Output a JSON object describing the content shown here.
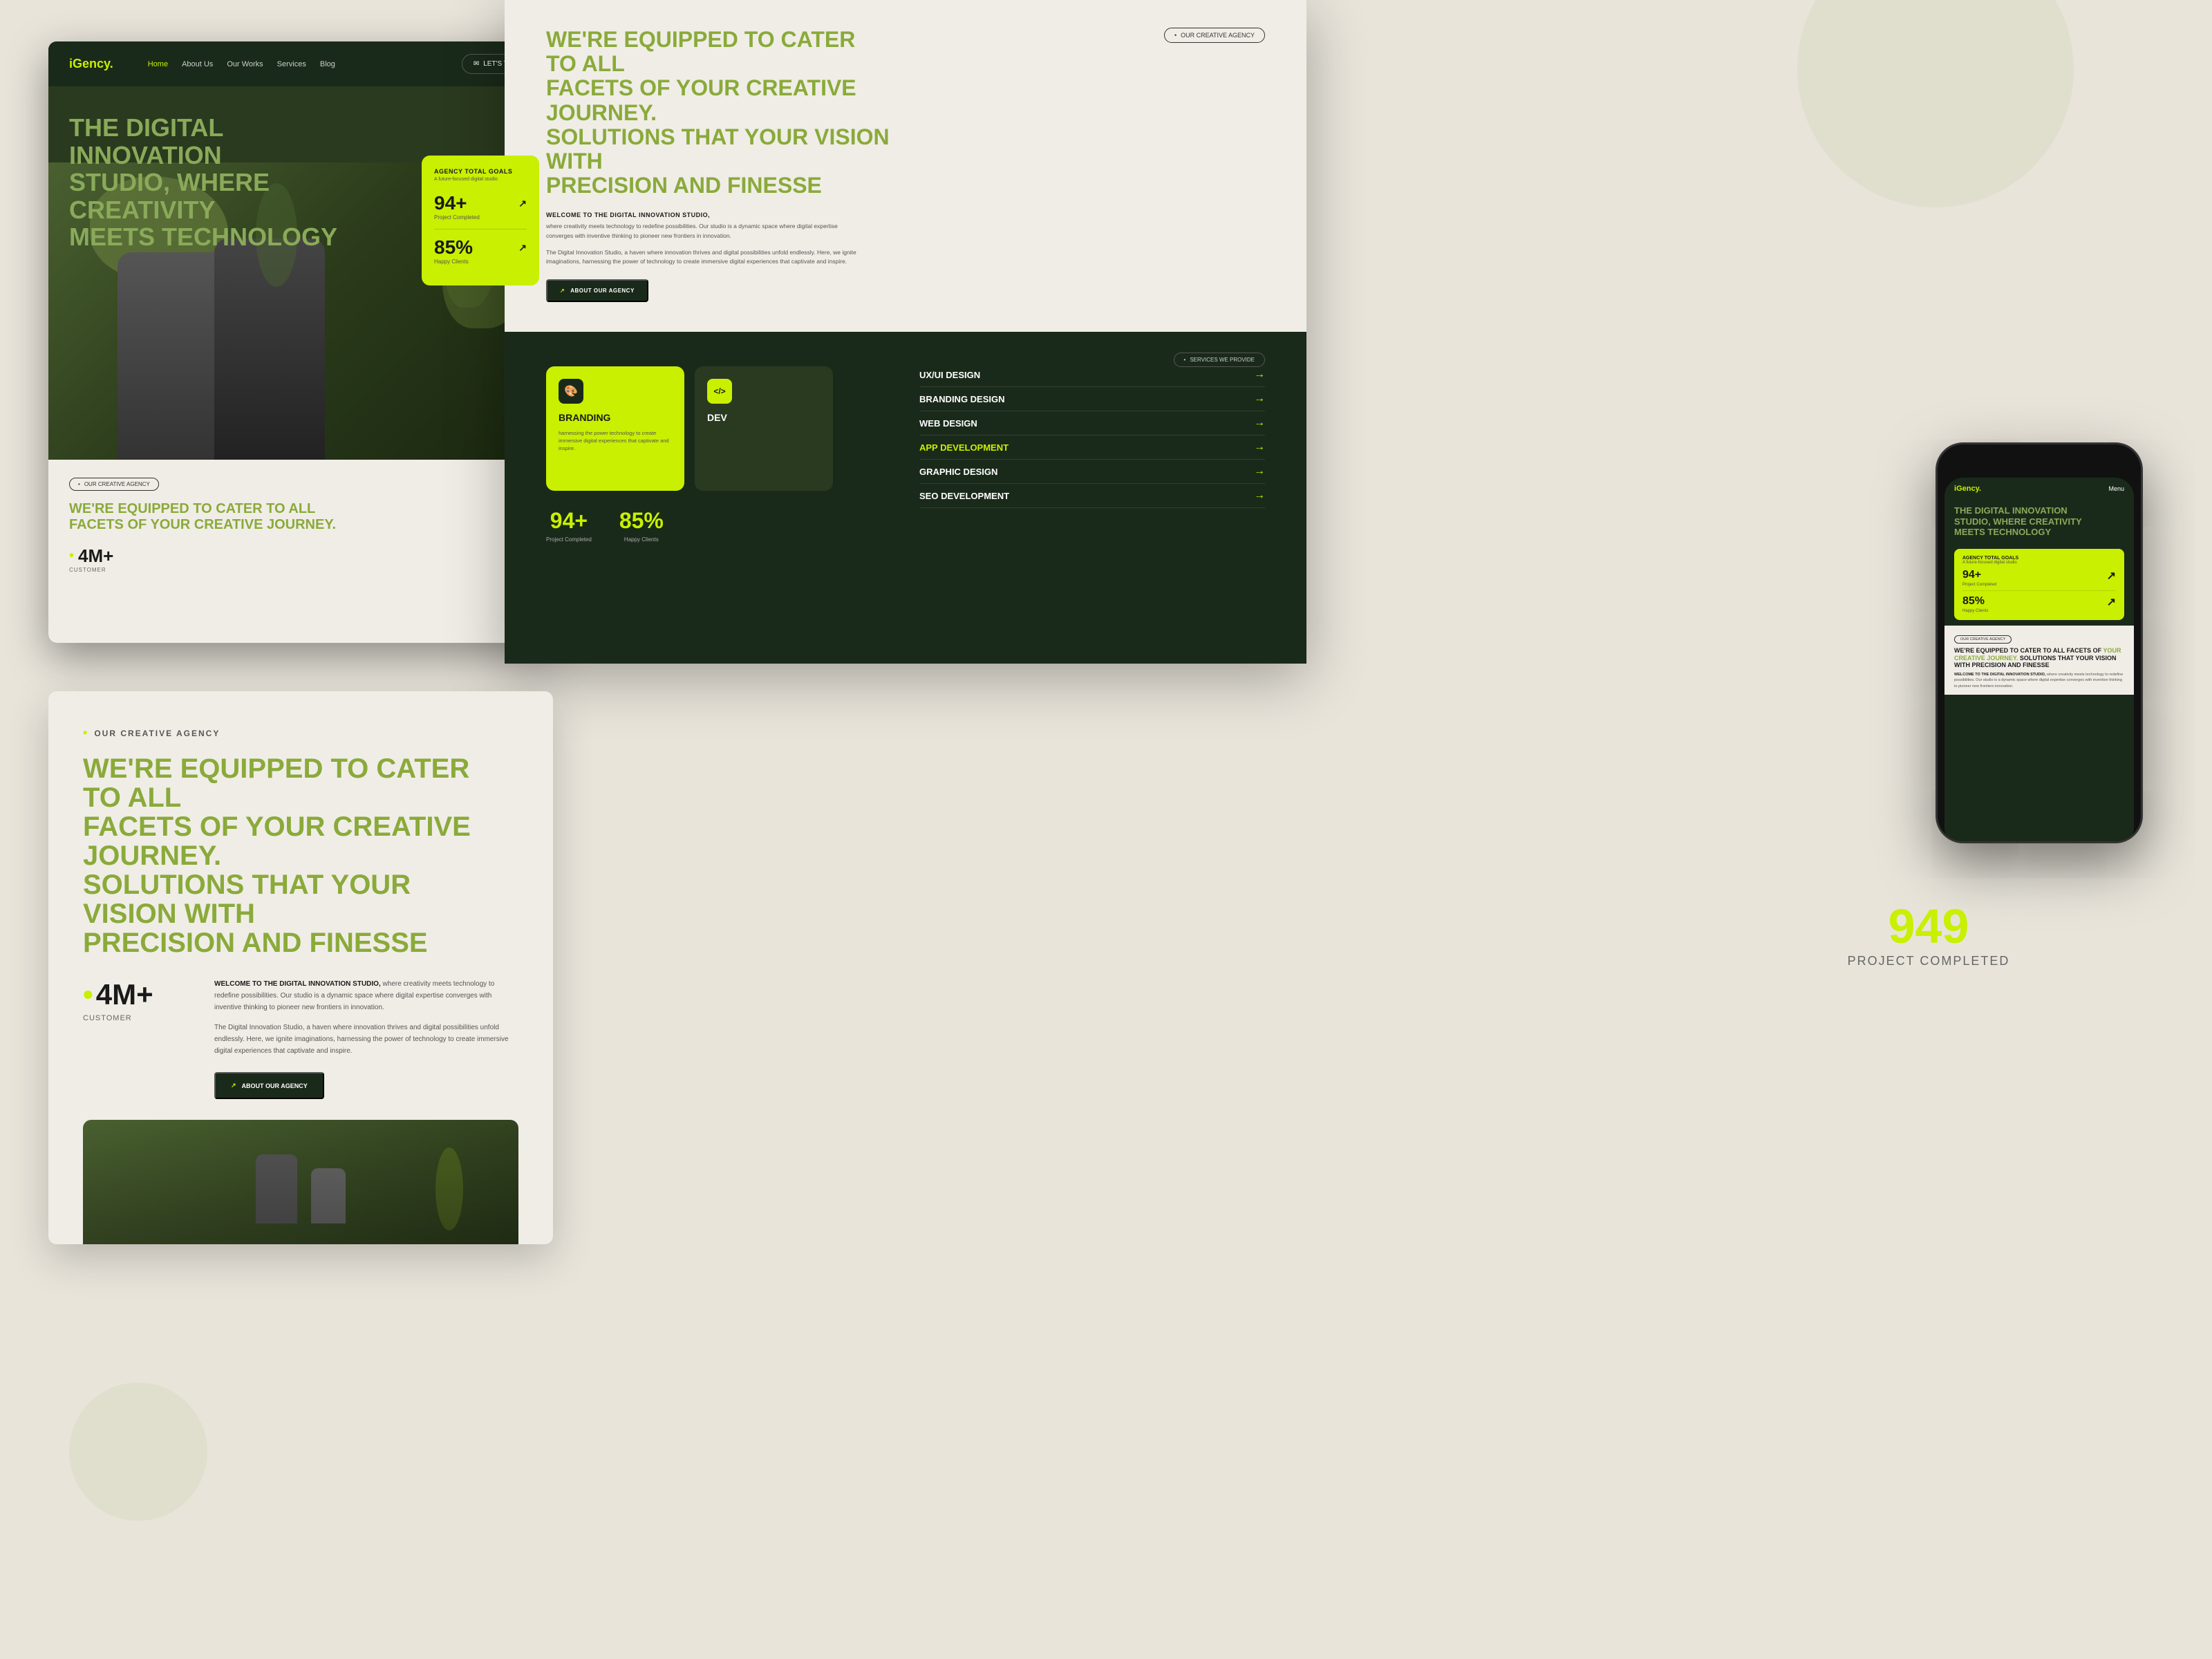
{
  "brand": {
    "logo": "iGency.",
    "logo_prefix": "i",
    "logo_suffix": "Gency."
  },
  "nav": {
    "home": "Home",
    "about": "About Us",
    "works": "Our Works",
    "services": "Services",
    "blog": "Blog",
    "cta": "LET'S TALK"
  },
  "hero": {
    "title_line1": "THE DIGITAL INNOVATION",
    "title_line2": "STUDIO,",
    "title_highlight": "WHERE CREATIVITY",
    "title_line3": "MEETS TECHNOLOGY"
  },
  "stats_card": {
    "title": "AGENCY TOTAL GOALS",
    "subtitle": "A future-focused digital studio",
    "project_num": "94+",
    "project_label": "Project Completed",
    "happy_num": "85%",
    "happy_label": "Happy Clients"
  },
  "about": {
    "tag": "OUR CREATIVE AGENCY",
    "heading_line1": "WE'RE EQUIPPED TO CATER TO ALL",
    "heading_line2": "FACETS OF",
    "heading_highlight": "YOUR CREATIVE JOURNEY.",
    "heading_line3": "SOLUTIONS THAT YOUR VISION WITH",
    "heading_line4": "PRECISION AND FINESSE",
    "bold_intro": "WELCOME TO THE DIGITAL INNOVATION STUDIO,",
    "para1": "where creativity meets technology to redefine possibilities. Our studio is a dynamic space where digital expertise converges with inventive thinking to pioneer new frontiers in innovation.",
    "para2": "The Digital Innovation Studio, a haven where innovation thrives and digital possibilities unfold endlessly. Here, we ignite imaginations, harnessing the power of technology to create immersive digital experiences that captivate and inspire.",
    "cta": "ABOUT OUR AGENCY",
    "stat_customers": "4M+",
    "stat_customers_label": "CUSTOMER"
  },
  "services": {
    "tag": "SERVICES WE PROVIDE",
    "card1_title": "BRANDING",
    "card1_text": "harnessing the power technology to create immersive digital experiences that captivate and inspire.",
    "card2_icon": "</>",
    "card2_title": "DEV",
    "service_list": [
      {
        "label": "UX/UI DESIGN",
        "highlighted": false
      },
      {
        "label": "BRANDING DESIGN",
        "highlighted": false
      },
      {
        "label": "WEB DESIGN",
        "highlighted": false
      },
      {
        "label": "APP DEVELOPMENT",
        "highlighted": true
      },
      {
        "label": "GRAPHIC DESIGN",
        "highlighted": false
      },
      {
        "label": "SEO DEVELOPMENT",
        "highlighted": false
      }
    ]
  },
  "large_stat": {
    "number": "949",
    "label": "Project Completed"
  },
  "phone": {
    "menu_label": "Menu"
  }
}
